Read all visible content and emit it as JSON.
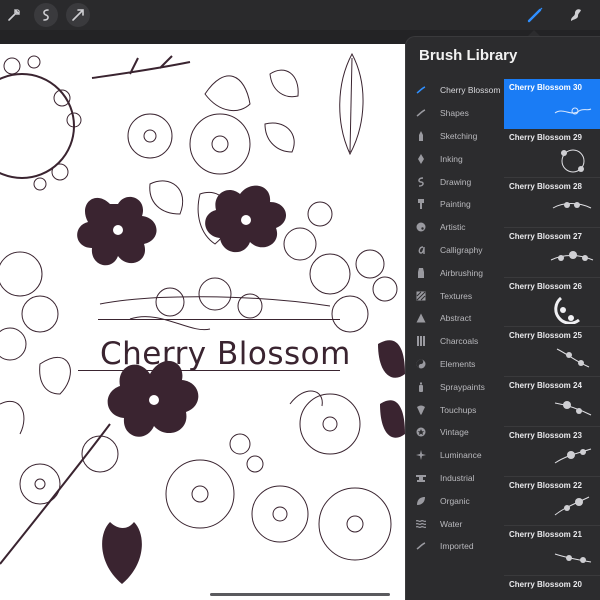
{
  "toolbar": {
    "left_tools": [
      {
        "icon": "wrench-icon"
      },
      {
        "icon": "adjustments-icon"
      },
      {
        "icon": "selection-arrow-icon"
      }
    ],
    "right_tools": [
      {
        "icon": "brush-icon",
        "active": true
      },
      {
        "icon": "smudge-icon",
        "active": false
      }
    ]
  },
  "canvas": {
    "title": "Cherry Blossom"
  },
  "brush_library": {
    "title": "Brush Library",
    "categories": [
      {
        "label": "Cherry Blossom",
        "icon": "stroke-icon",
        "active": true
      },
      {
        "label": "Shapes",
        "icon": "stroke-icon"
      },
      {
        "label": "Sketching",
        "icon": "pencil-icon"
      },
      {
        "label": "Inking",
        "icon": "pen-nib-icon"
      },
      {
        "label": "Drawing",
        "icon": "swirl-icon"
      },
      {
        "label": "Painting",
        "icon": "paint-brush-icon"
      },
      {
        "label": "Artistic",
        "icon": "palette-icon"
      },
      {
        "label": "Calligraphy",
        "icon": "calligraphy-icon"
      },
      {
        "label": "Airbrushing",
        "icon": "airbrush-icon"
      },
      {
        "label": "Textures",
        "icon": "texture-icon"
      },
      {
        "label": "Abstract",
        "icon": "triangle-icon"
      },
      {
        "label": "Charcoals",
        "icon": "charcoal-icon"
      },
      {
        "label": "Elements",
        "icon": "yin-yang-icon"
      },
      {
        "label": "Spraypaints",
        "icon": "spray-can-icon"
      },
      {
        "label": "Touchups",
        "icon": "touchup-icon"
      },
      {
        "label": "Vintage",
        "icon": "star-badge-icon"
      },
      {
        "label": "Luminance",
        "icon": "sparkle-icon"
      },
      {
        "label": "Industrial",
        "icon": "anvil-icon"
      },
      {
        "label": "Organic",
        "icon": "leaf-icon"
      },
      {
        "label": "Water",
        "icon": "waves-icon"
      },
      {
        "label": "Imported",
        "icon": "stroke-icon"
      }
    ],
    "brushes": [
      {
        "name": "Cherry Blossom 30",
        "active": true
      },
      {
        "name": "Cherry Blossom 29"
      },
      {
        "name": "Cherry Blossom 28"
      },
      {
        "name": "Cherry Blossom 27"
      },
      {
        "name": "Cherry Blossom 26"
      },
      {
        "name": "Cherry Blossom 25"
      },
      {
        "name": "Cherry Blossom 24"
      },
      {
        "name": "Cherry Blossom 23"
      },
      {
        "name": "Cherry Blossom 22"
      },
      {
        "name": "Cherry Blossom 21"
      },
      {
        "name": "Cherry Blossom 20"
      }
    ]
  },
  "colors": {
    "accent": "#1a7cf5",
    "panel": "#2c2c2e",
    "ink": "#3a2430"
  }
}
